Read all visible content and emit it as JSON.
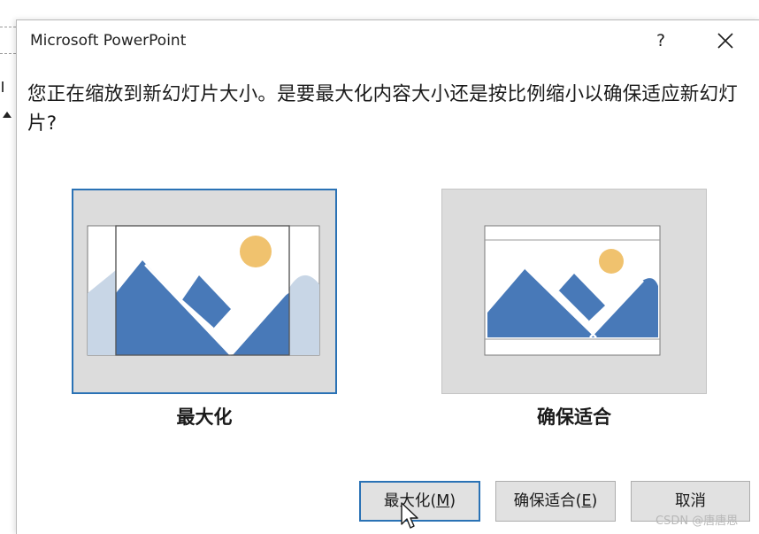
{
  "dialog": {
    "title": "Microsoft PowerPoint",
    "help_label": "?",
    "message": "您正在缩放到新幻灯片大小。是要最大化内容大小还是按比例缩小以确保适应新幻灯片?"
  },
  "options": [
    {
      "label": "最大化",
      "selected": true
    },
    {
      "label": "确保适合",
      "selected": false
    }
  ],
  "buttons": {
    "maximize": {
      "text": "最大化(",
      "key": "M",
      "suffix": ")"
    },
    "fit": {
      "text": "确保适合(",
      "key": "E",
      "suffix": ")"
    },
    "cancel": {
      "label": "取消"
    }
  },
  "watermark": "CSDN @唐唐思",
  "colors": {
    "accent": "#2a72b5",
    "mountain": "#4879b8",
    "mountain_faded": "#c8d6e6",
    "sun": "#f0c26e",
    "button_bg": "#e1e1e1"
  },
  "icons": [
    "close-icon",
    "landscape-picture-icon",
    "mouse-cursor-icon"
  ]
}
